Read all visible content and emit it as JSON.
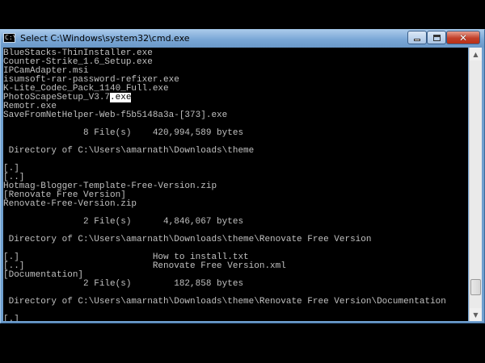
{
  "window": {
    "title": "Select C:\\Windows\\system32\\cmd.exe",
    "icon_label": "C:\\",
    "icons": {
      "app": "cmd-console-icon",
      "minimize": "minimize-icon",
      "maximize": "maximize-icon",
      "close": "close-icon",
      "scroll_up": "scroll-up-arrow-icon",
      "scroll_down": "scroll-down-arrow-icon"
    },
    "colors": {
      "titlebar": "#7aa7d6",
      "console_bg": "#000000",
      "console_text": "#c0c0c0",
      "close_button": "#c2402a"
    },
    "scroll_position_fraction": 0.95
  },
  "console": {
    "lines": [
      "BlueStacks-ThinInstaller.exe",
      "Counter-Strike_1.6_Setup.exe",
      "IPCamAdapter.msi",
      "isumsoft-rar-password-refixer.exe",
      "K-Lite_Codec_Pack_1140_Full.exe",
      "PhotoScapeSetup_V3.7",
      "Remotr.exe",
      "SaveFromNetHelper-Web-f5b5148a3a-[373].exe",
      "",
      "               8 File(s)    420,994,589 bytes",
      "",
      " Directory of C:\\Users\\amarnath\\Downloads\\theme",
      "",
      "[.]",
      "[..]",
      "Hotmag-Blogger-Template-Free-Version.zip",
      "[Renovate Free Version]",
      "Renovate-Free-Version.zip",
      "",
      "               2 File(s)      4,846,067 bytes",
      "",
      " Directory of C:\\Users\\amarnath\\Downloads\\theme\\Renovate Free Version",
      "",
      "[.]                         How to install.txt",
      "[..]                        Renovate Free Version.xml",
      "[Documentation]",
      "               2 File(s)        182,858 bytes",
      "",
      " Directory of C:\\Users\\amarnath\\Downloads\\theme\\Renovate Free Version\\Documentation",
      "",
      "[.]"
    ],
    "selected_text": ".exe"
  }
}
